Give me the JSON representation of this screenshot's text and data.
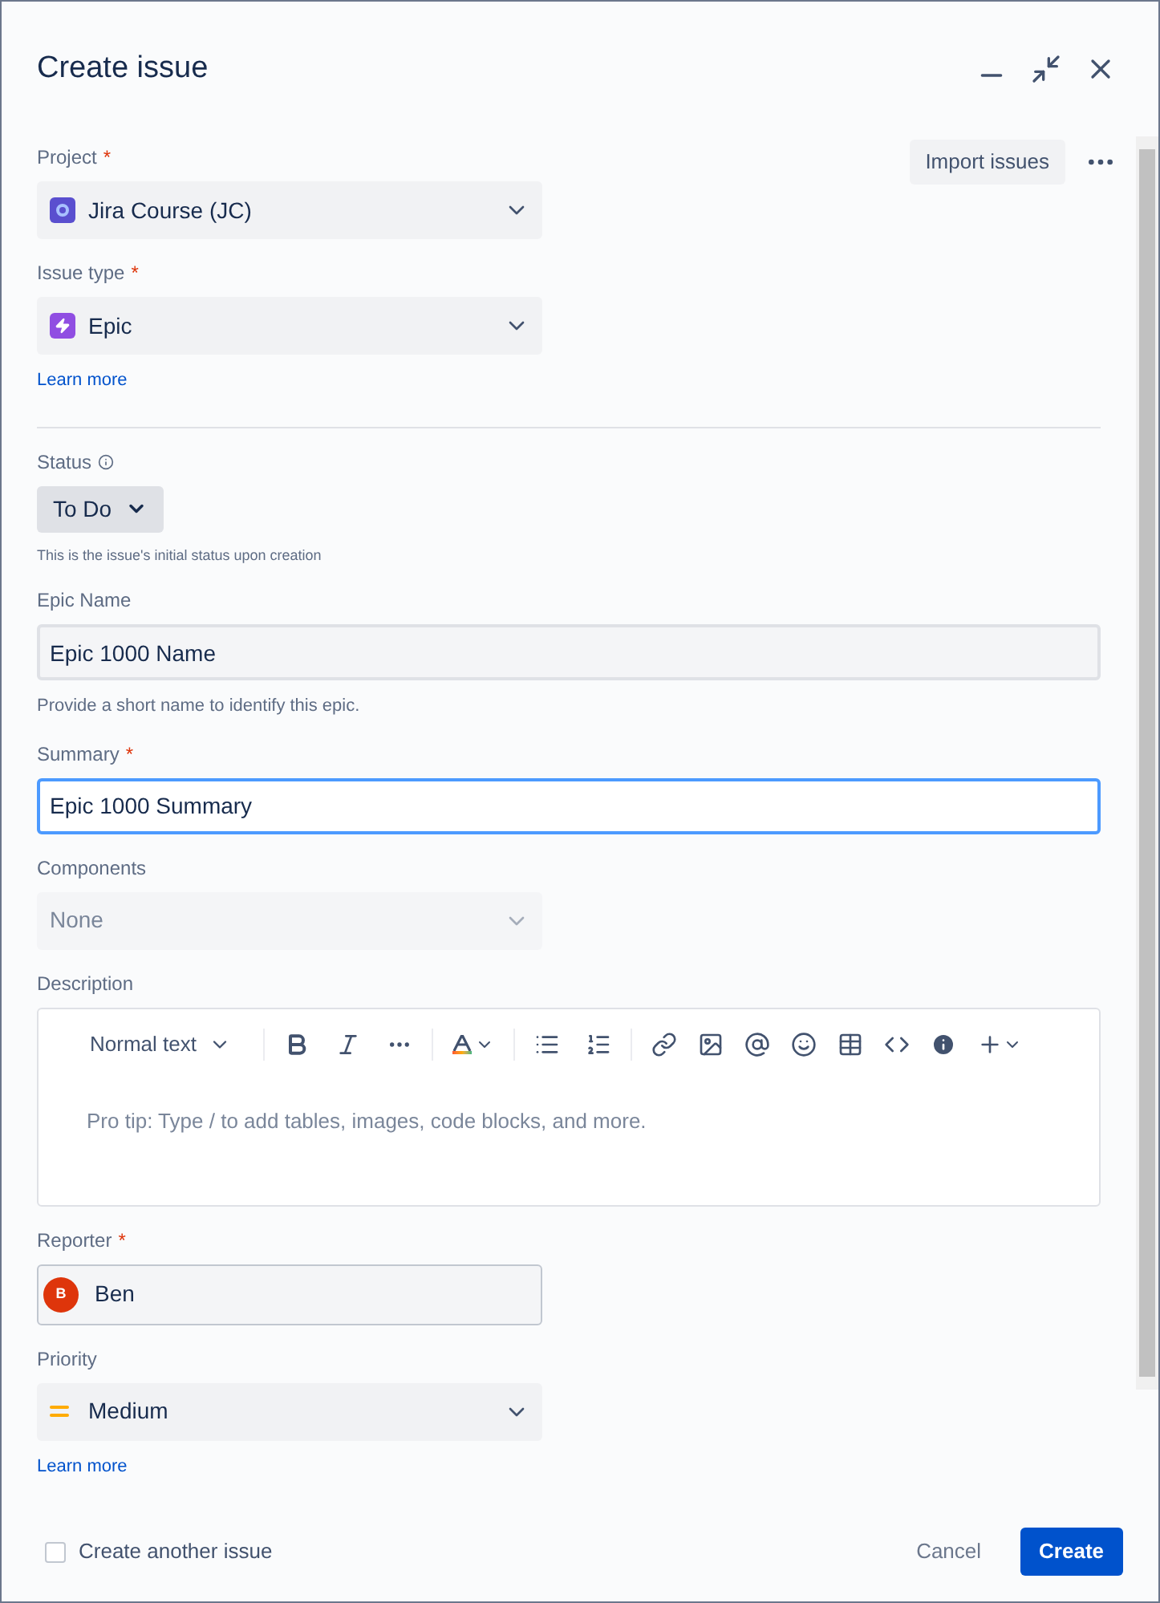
{
  "window": {
    "title": "Create issue"
  },
  "top_actions": {
    "import_button": "Import issues"
  },
  "fields": [
    {
      "kind": "select",
      "label": "Project",
      "required_mark": "*",
      "value": "Jira Course (JC)",
      "disabled": false
    },
    {
      "kind": "select",
      "label": "Issue type",
      "required_mark": "*",
      "value": "Epic",
      "disabled": false,
      "link": "Learn more",
      "divider": true
    },
    {
      "kind": "status",
      "label": "Status",
      "value": "To Do",
      "help": "This is the issue's initial status upon creation"
    },
    {
      "kind": "text",
      "label": "Epic Name",
      "value": "Epic 1000 Name",
      "focused": false,
      "help": "Provide a short name to identify this epic."
    },
    {
      "kind": "text",
      "label": "Summary",
      "required_mark": "*",
      "value": "Epic 1000 Summary",
      "focused": true
    },
    {
      "kind": "select",
      "label": "Components",
      "value": "None",
      "disabled": true
    },
    {
      "kind": "editor",
      "label": "Description",
      "text_style": "Normal text",
      "placeholder": "Pro tip: Type / to add tables, images, code blocks, and more."
    },
    {
      "kind": "user",
      "label": "Reporter",
      "required_mark": "*",
      "value": "Ben",
      "initial": "B"
    },
    {
      "kind": "select",
      "label": "Priority",
      "value": "Medium",
      "disabled": false,
      "link": "Learn more"
    }
  ],
  "footer": {
    "create_another": {
      "label": "Create another issue",
      "checked": false
    },
    "cancel": "Cancel",
    "create": "Create"
  }
}
